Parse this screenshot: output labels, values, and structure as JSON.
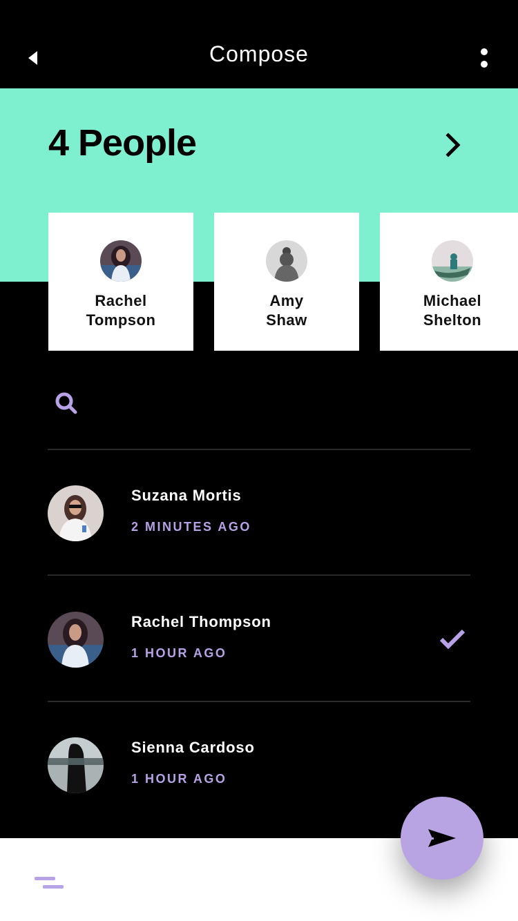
{
  "header": {
    "title": "Compose",
    "back_icon": "back-arrow-icon",
    "more_icon": "kebab-menu-icon"
  },
  "selection": {
    "title": "4 People",
    "next_icon": "chevron-right-icon",
    "cards": [
      {
        "first": "Rachel",
        "last": "Tompson"
      },
      {
        "first": "Amy",
        "last": "Shaw"
      },
      {
        "first": "Michael",
        "last": "Shelton"
      }
    ]
  },
  "search": {
    "icon": "search-icon",
    "placeholder": "",
    "value": ""
  },
  "contacts": [
    {
      "name": "Suzana Mortis",
      "time": "2 MINUTES AGO",
      "selected": false
    },
    {
      "name": "Rachel Thompson",
      "time": "1 HOUR AGO",
      "selected": true
    },
    {
      "name": "Sienna Cardoso",
      "time": "1 HOUR AGO",
      "selected": false
    }
  ],
  "bottom_bar": {
    "menu_icon": "hamburger-menu-icon",
    "send_icon": "send-icon"
  },
  "colors": {
    "accent_mint": "#7ef0cf",
    "accent_lavender": "#b7a2e6",
    "background": "#000000",
    "card": "#ffffff"
  }
}
